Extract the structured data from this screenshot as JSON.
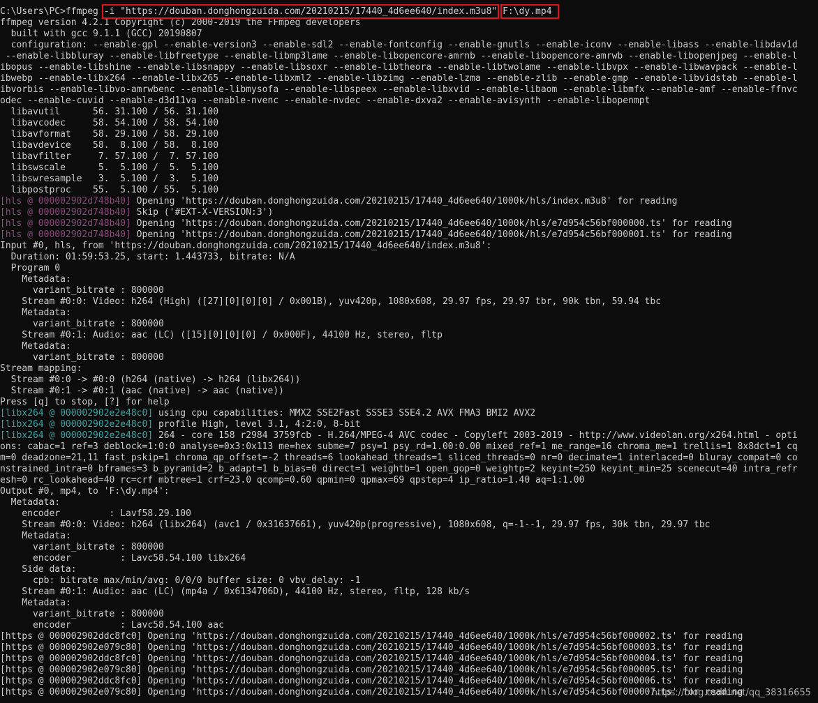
{
  "terminal": {
    "lines": [
      [
        {
          "t": "C:\\Users\\PC>ffmpeg ",
          "c": "seg-white"
        },
        {
          "t": "-i \"https://douban.donghongzuida.com/20210215/17440_4d6ee640/index.m3u8\"",
          "c": "seg-highlight"
        },
        {
          "t": " ",
          "c": "seg-white"
        },
        {
          "t": "F:\\dy.mp4 ",
          "c": "seg-highlight"
        }
      ],
      [
        {
          "t": "ffmpeg version 4.2.1 Copyright (c) 2000-2019 the FFmpeg developers",
          "c": "seg-white"
        }
      ],
      [
        {
          "t": "  built with gcc 9.1.1 (GCC) 20190807",
          "c": "seg-white"
        }
      ],
      [
        {
          "t": "  configuration: --enable-gpl --enable-version3 --enable-sdl2 --enable-fontconfig --enable-gnutls --enable-iconv --enable-libass --enable-libdav1d",
          "c": "seg-white"
        }
      ],
      [
        {
          "t": " --enable-libbluray --enable-libfreetype --enable-libmp3lame --enable-libopencore-amrnb --enable-libopencore-amrwb --enable-libopenjpeg --enable-l",
          "c": "seg-white"
        }
      ],
      [
        {
          "t": "ibopus --enable-libshine --enable-libsnappy --enable-libsoxr --enable-libtheora --enable-libtwolame --enable-libvpx --enable-libwavpack --enable-l",
          "c": "seg-white"
        }
      ],
      [
        {
          "t": "ibwebp --enable-libx264 --enable-libx265 --enable-libxml2 --enable-libzimg --enable-lzma --enable-zlib --enable-gmp --enable-libvidstab --enable-l",
          "c": "seg-white"
        }
      ],
      [
        {
          "t": "ibvorbis --enable-libvo-amrwbenc --enable-libmysofa --enable-libspeex --enable-libxvid --enable-libaom --enable-libmfx --enable-amf --enable-ffnvc",
          "c": "seg-white"
        }
      ],
      [
        {
          "t": "odec --enable-cuvid --enable-d3d11va --enable-nvenc --enable-nvdec --enable-dxva2 --enable-avisynth --enable-libopenmpt",
          "c": "seg-white"
        }
      ],
      [
        {
          "t": "  libavutil      56. 31.100 / 56. 31.100",
          "c": "seg-white"
        }
      ],
      [
        {
          "t": "  libavcodec     58. 54.100 / 58. 54.100",
          "c": "seg-white"
        }
      ],
      [
        {
          "t": "  libavformat    58. 29.100 / 58. 29.100",
          "c": "seg-white"
        }
      ],
      [
        {
          "t": "  libavdevice    58.  8.100 / 58.  8.100",
          "c": "seg-white"
        }
      ],
      [
        {
          "t": "  libavfilter     7. 57.100 /  7. 57.100",
          "c": "seg-white"
        }
      ],
      [
        {
          "t": "  libswscale      5.  5.100 /  5.  5.100",
          "c": "seg-white"
        }
      ],
      [
        {
          "t": "  libswresample   3.  5.100 /  3.  5.100",
          "c": "seg-white"
        }
      ],
      [
        {
          "t": "  libpostproc    55.  5.100 / 55.  5.100",
          "c": "seg-white"
        }
      ],
      [
        {
          "t": "[hls @ 000002902d748b40] ",
          "c": "seg-hls"
        },
        {
          "t": "Opening 'https://douban.donghongzuida.com/20210215/17440_4d6ee640/1000k/hls/index.m3u8' for reading",
          "c": "seg-white"
        }
      ],
      [
        {
          "t": "[hls @ 000002902d748b40] ",
          "c": "seg-hls"
        },
        {
          "t": "Skip ('#EXT-X-VERSION:3')",
          "c": "seg-white"
        }
      ],
      [
        {
          "t": "[hls @ 000002902d748b40] ",
          "c": "seg-hls"
        },
        {
          "t": "Opening 'https://douban.donghongzuida.com/20210215/17440_4d6ee640/1000k/hls/e7d954c56bf000000.ts' for reading",
          "c": "seg-white"
        }
      ],
      [
        {
          "t": "[hls @ 000002902d748b40] ",
          "c": "seg-hls"
        },
        {
          "t": "Opening 'https://douban.donghongzuida.com/20210215/17440_4d6ee640/1000k/hls/e7d954c56bf000001.ts' for reading",
          "c": "seg-white"
        }
      ],
      [
        {
          "t": "Input #0, hls, from 'https://douban.donghongzuida.com/20210215/17440_4d6ee640/index.m3u8':",
          "c": "seg-white"
        }
      ],
      [
        {
          "t": "  Duration: 01:59:53.25, start: 1.443733, bitrate: N/A",
          "c": "seg-white"
        }
      ],
      [
        {
          "t": "  Program 0",
          "c": "seg-white"
        }
      ],
      [
        {
          "t": "    Metadata:",
          "c": "seg-white"
        }
      ],
      [
        {
          "t": "      variant_bitrate : 800000",
          "c": "seg-white"
        }
      ],
      [
        {
          "t": "    Stream #0:0: Video: h264 (High) ([27][0][0][0] / 0x001B), yuv420p, 1080x608, 29.97 fps, 29.97 tbr, 90k tbn, 59.94 tbc",
          "c": "seg-white"
        }
      ],
      [
        {
          "t": "    Metadata:",
          "c": "seg-white"
        }
      ],
      [
        {
          "t": "      variant_bitrate : 800000",
          "c": "seg-white"
        }
      ],
      [
        {
          "t": "    Stream #0:1: Audio: aac (LC) ([15][0][0][0] / 0x000F), 44100 Hz, stereo, fltp",
          "c": "seg-white"
        }
      ],
      [
        {
          "t": "    Metadata:",
          "c": "seg-white"
        }
      ],
      [
        {
          "t": "      variant_bitrate : 800000",
          "c": "seg-white"
        }
      ],
      [
        {
          "t": "Stream mapping:",
          "c": "seg-white"
        }
      ],
      [
        {
          "t": "  Stream #0:0 -> #0:0 (h264 (native) -> h264 (libx264))",
          "c": "seg-white"
        }
      ],
      [
        {
          "t": "  Stream #0:1 -> #0:1 (aac (native) -> aac (native))",
          "c": "seg-white"
        }
      ],
      [
        {
          "t": "Press [q] to stop, [?] for help",
          "c": "seg-white"
        }
      ],
      [
        {
          "t": "[libx264 @ 000002902e2e48c0] ",
          "c": "seg-libx"
        },
        {
          "t": "using cpu capabilities: MMX2 SSE2Fast SSSE3 SSE4.2 AVX FMA3 BMI2 AVX2",
          "c": "seg-white"
        }
      ],
      [
        {
          "t": "[libx264 @ 000002902e2e48c0] ",
          "c": "seg-libx"
        },
        {
          "t": "profile High, level 3.1, 4:2:0, 8-bit",
          "c": "seg-white"
        }
      ],
      [
        {
          "t": "[libx264 @ 000002902e2e48c0] ",
          "c": "seg-libx"
        },
        {
          "t": "264 - core 158 r2984 3759fcb - H.264/MPEG-4 AVC codec - Copyleft 2003-2019 - http://www.videolan.org/x264.html - opti",
          "c": "seg-white"
        }
      ],
      [
        {
          "t": "ons: cabac=1 ref=3 deblock=1:0:0 analyse=0x3:0x113 me=hex subme=7 psy=1 psy_rd=1.00:0.00 mixed_ref=1 me_range=16 chroma_me=1 trellis=1 8x8dct=1 cq",
          "c": "seg-white"
        }
      ],
      [
        {
          "t": "m=0 deadzone=21,11 fast_pskip=1 chroma_qp_offset=-2 threads=6 lookahead_threads=1 sliced_threads=0 nr=0 decimate=1 interlaced=0 bluray_compat=0 co",
          "c": "seg-white"
        }
      ],
      [
        {
          "t": "nstrained_intra=0 bframes=3 b_pyramid=2 b_adapt=1 b_bias=0 direct=1 weightb=1 open_gop=0 weightp=2 keyint=250 keyint_min=25 scenecut=40 intra_refr",
          "c": "seg-white"
        }
      ],
      [
        {
          "t": "esh=0 rc_lookahead=40 rc=crf mbtree=1 crf=23.0 qcomp=0.60 qpmin=0 qpmax=69 qpstep=4 ip_ratio=1.40 aq=1:1.00",
          "c": "seg-white"
        }
      ],
      [
        {
          "t": "Output #0, mp4, to 'F:\\dy.mp4':",
          "c": "seg-white"
        }
      ],
      [
        {
          "t": "  Metadata:",
          "c": "seg-white"
        }
      ],
      [
        {
          "t": "    encoder         : Lavf58.29.100",
          "c": "seg-white"
        }
      ],
      [
        {
          "t": "    Stream #0:0: Video: h264 (libx264) (avc1 / 0x31637661), yuv420p(progressive), 1080x608, q=-1--1, 29.97 fps, 30k tbn, 29.97 tbc",
          "c": "seg-white"
        }
      ],
      [
        {
          "t": "    Metadata:",
          "c": "seg-white"
        }
      ],
      [
        {
          "t": "      variant_bitrate : 800000",
          "c": "seg-white"
        }
      ],
      [
        {
          "t": "      encoder         : Lavc58.54.100 libx264",
          "c": "seg-white"
        }
      ],
      [
        {
          "t": "    Side data:",
          "c": "seg-white"
        }
      ],
      [
        {
          "t": "      cpb: bitrate max/min/avg: 0/0/0 buffer size: 0 vbv_delay: -1",
          "c": "seg-white"
        }
      ],
      [
        {
          "t": "    Stream #0:1: Audio: aac (LC) (mp4a / 0x6134706D), 44100 Hz, stereo, fltp, 128 kb/s",
          "c": "seg-white"
        }
      ],
      [
        {
          "t": "    Metadata:",
          "c": "seg-white"
        }
      ],
      [
        {
          "t": "      variant_bitrate : 800000",
          "c": "seg-white"
        }
      ],
      [
        {
          "t": "      encoder         : Lavc58.54.100 aac",
          "c": "seg-white"
        }
      ],
      [
        {
          "t": "[https @ 000002902ddc8fc0] Opening 'https://douban.donghongzuida.com/20210215/17440_4d6ee640/1000k/hls/e7d954c56bf000002.ts' for reading",
          "c": "seg-white"
        }
      ],
      [
        {
          "t": "[https @ 000002902e079c80] Opening 'https://douban.donghongzuida.com/20210215/17440_4d6ee640/1000k/hls/e7d954c56bf000003.ts' for reading",
          "c": "seg-white"
        }
      ],
      [
        {
          "t": "[https @ 000002902ddc8fc0] Opening 'https://douban.donghongzuida.com/20210215/17440_4d6ee640/1000k/hls/e7d954c56bf000004.ts' for reading",
          "c": "seg-white"
        }
      ],
      [
        {
          "t": "[https @ 000002902e079c80] Opening 'https://douban.donghongzuida.com/20210215/17440_4d6ee640/1000k/hls/e7d954c56bf000005.ts' for reading",
          "c": "seg-white"
        }
      ],
      [
        {
          "t": "[https @ 000002902ddc8fc0] Opening 'https://douban.donghongzuida.com/20210215/17440_4d6ee640/1000k/hls/e7d954c56bf000006.ts' for reading",
          "c": "seg-white"
        }
      ],
      [
        {
          "t": "[https @ 000002902e079c80] Opening 'https://douban.donghongzuida.com/20210215/17440_4d6ee640/1000k/hls/e7d954c56bf000007.ts' for reading",
          "c": "seg-white"
        }
      ]
    ]
  },
  "watermark": "https://blog.csdn.net/qq_38316655",
  "colors": {
    "background": "#0c0c0c",
    "text": "#cccccc",
    "hls_prefix": "#8a4a7a",
    "libx264_prefix": "#3aa7a7",
    "highlight_box": "#e2141c"
  }
}
